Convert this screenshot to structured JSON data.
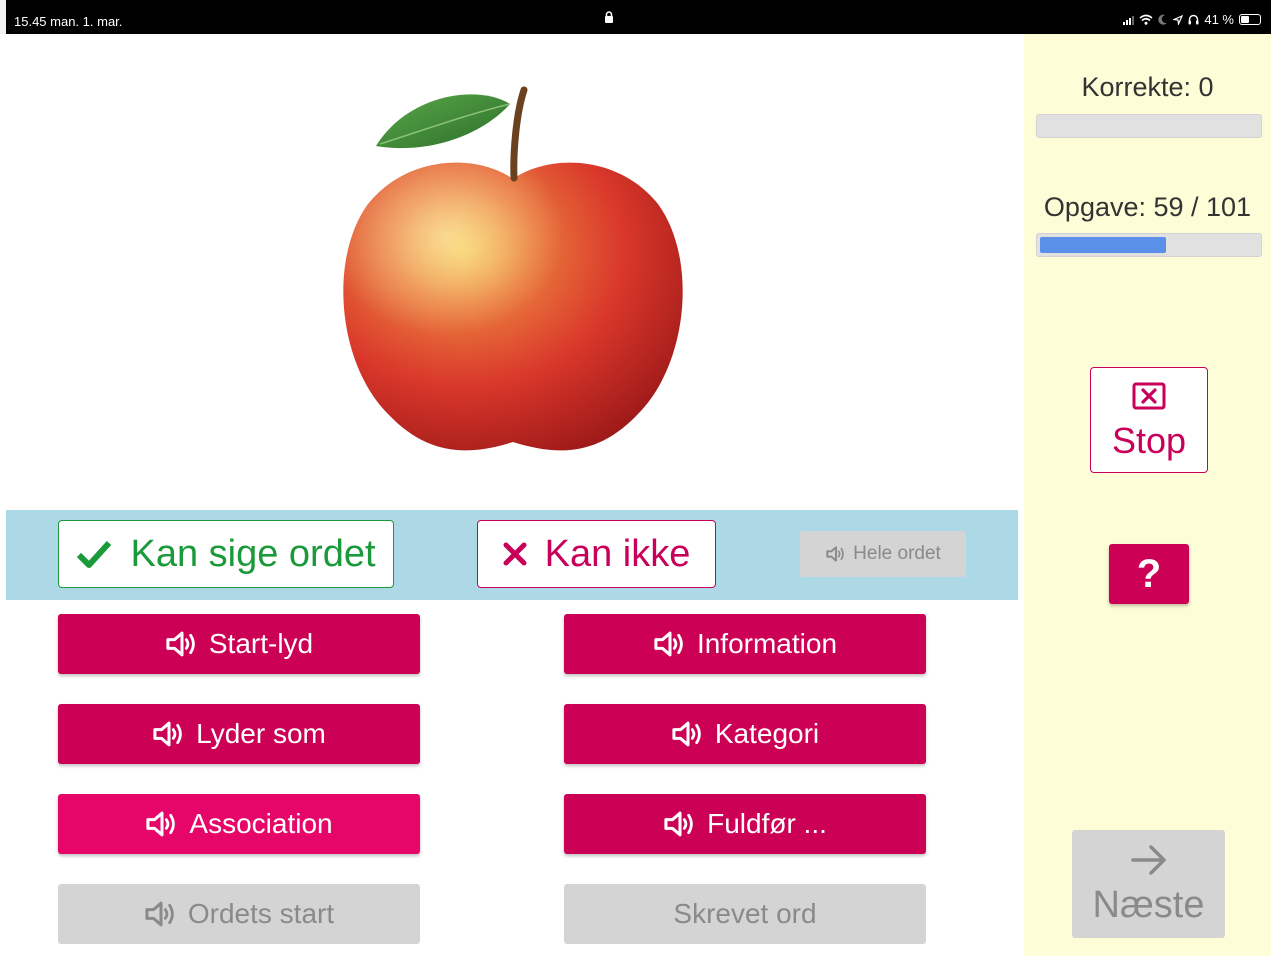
{
  "status_bar": {
    "time_date": "15.45  man. 1. mar.",
    "battery_text": "41 %"
  },
  "main": {
    "image": "apple",
    "answer_bar": {
      "can_say": "Kan sige ordet",
      "cannot": "Kan ikke",
      "whole_word": "Hele ordet"
    },
    "hints": [
      {
        "label": "Start-lyd",
        "state": "active"
      },
      {
        "label": "Information",
        "state": "active"
      },
      {
        "label": "Lyder som",
        "state": "active"
      },
      {
        "label": "Kategori",
        "state": "active"
      },
      {
        "label": "Association",
        "state": "highlighted"
      },
      {
        "label": "Fuldfør ...",
        "state": "active"
      },
      {
        "label": "Ordets start",
        "state": "disabled"
      },
      {
        "label": "Skrevet ord",
        "state": "disabled"
      }
    ]
  },
  "sidebar": {
    "correct_label": "Korrekte: 0",
    "correct_progress": 0,
    "task_label": "Opgave: 59 / 101",
    "task_progress": 0.58,
    "stop_label": "Stop",
    "help_label": "?",
    "next_label": "Næste"
  },
  "colors": {
    "accent": "#cc0055",
    "accent_light": "#e6066a",
    "success": "#1a9a3a",
    "answer_bar_bg": "#add8e6",
    "sidebar_bg": "#fdfdd7",
    "progress_fill": "#5a90e8",
    "disabled_bg": "#d4d4d4"
  }
}
